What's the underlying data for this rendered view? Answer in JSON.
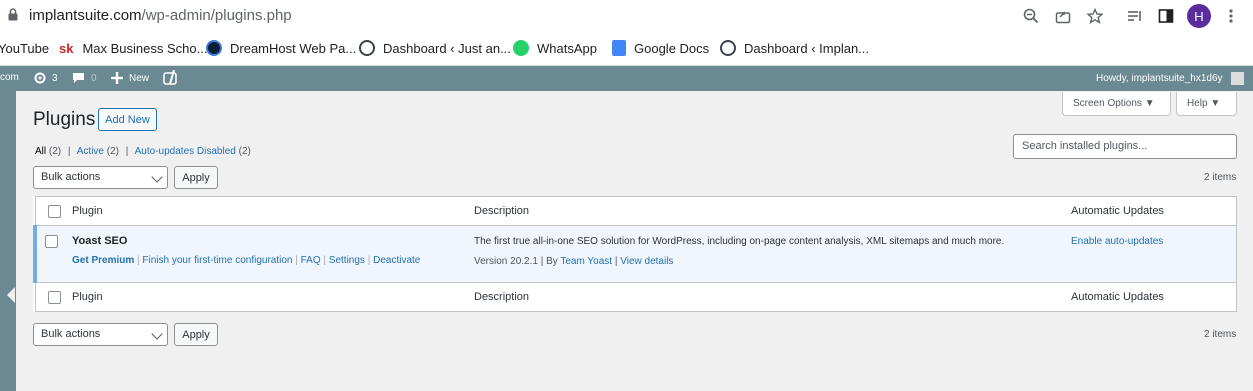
{
  "browser": {
    "url_host": "implantsuite.com",
    "url_path": "/wp-admin/plugins.php",
    "profile_initial": "H",
    "icons": [
      "lock-icon",
      "zoom-icon",
      "share-icon",
      "star-icon",
      "reading-list-icon",
      "side-panel-icon",
      "menu-dots-icon"
    ]
  },
  "bookmarks": [
    {
      "label": "YouTube",
      "icon": "youtube-icon"
    },
    {
      "label": "Max Business Scho...",
      "icon": "sk-icon"
    },
    {
      "label": "DreamHost Web Pa...",
      "icon": "dreamhost-icon"
    },
    {
      "label": "Dashboard ‹ Just an...",
      "icon": "wordpress-icon"
    },
    {
      "label": "WhatsApp",
      "icon": "whatsapp-icon"
    },
    {
      "label": "Google Docs",
      "icon": "google-docs-icon"
    },
    {
      "label": "Dashboard ‹ Implan...",
      "icon": "wordpress-icon"
    }
  ],
  "adminbar": {
    "site": "com",
    "updates_count": "3",
    "comments_count": "0",
    "new_label": "New",
    "howdy": "Howdy, implantsuite_hx1d6y"
  },
  "screen_options": {
    "screen_options_label": "Screen Options ▼",
    "help_label": "Help ▼"
  },
  "page": {
    "title": "Plugins",
    "add_new": "Add New",
    "filters": {
      "all": "All",
      "all_count": "(2)",
      "active": "Active",
      "active_count": "(2)",
      "auto_disabled": "Auto-updates Disabled",
      "auto_disabled_count": "(2)",
      "sep": "|"
    },
    "search_placeholder": "Search installed plugins...",
    "bulk_actions": "Bulk actions",
    "apply": "Apply",
    "items_count": "2 items"
  },
  "table": {
    "columns": {
      "plugin": "Plugin",
      "description": "Description",
      "auto": "Automatic Updates"
    },
    "rows": [
      {
        "name": "Yoast SEO",
        "actions": [
          "Get Premium",
          "Finish your first-time configuration",
          "FAQ",
          "Settings",
          "Deactivate"
        ],
        "description": "The first true all-in-one SEO solution for WordPress, including on-page content analysis, XML sitemaps and much more.",
        "version": "Version 20.2.1",
        "by": "By",
        "author": "Team Yoast",
        "view_details": "View details",
        "auto_update": "Enable auto-updates"
      }
    ]
  },
  "colors": {
    "admin_bar": "#6b8993",
    "link": "#2271b1",
    "active_row": "#f0f6fc",
    "active_border": "#72aee6",
    "profile": "#5b2c9c"
  }
}
